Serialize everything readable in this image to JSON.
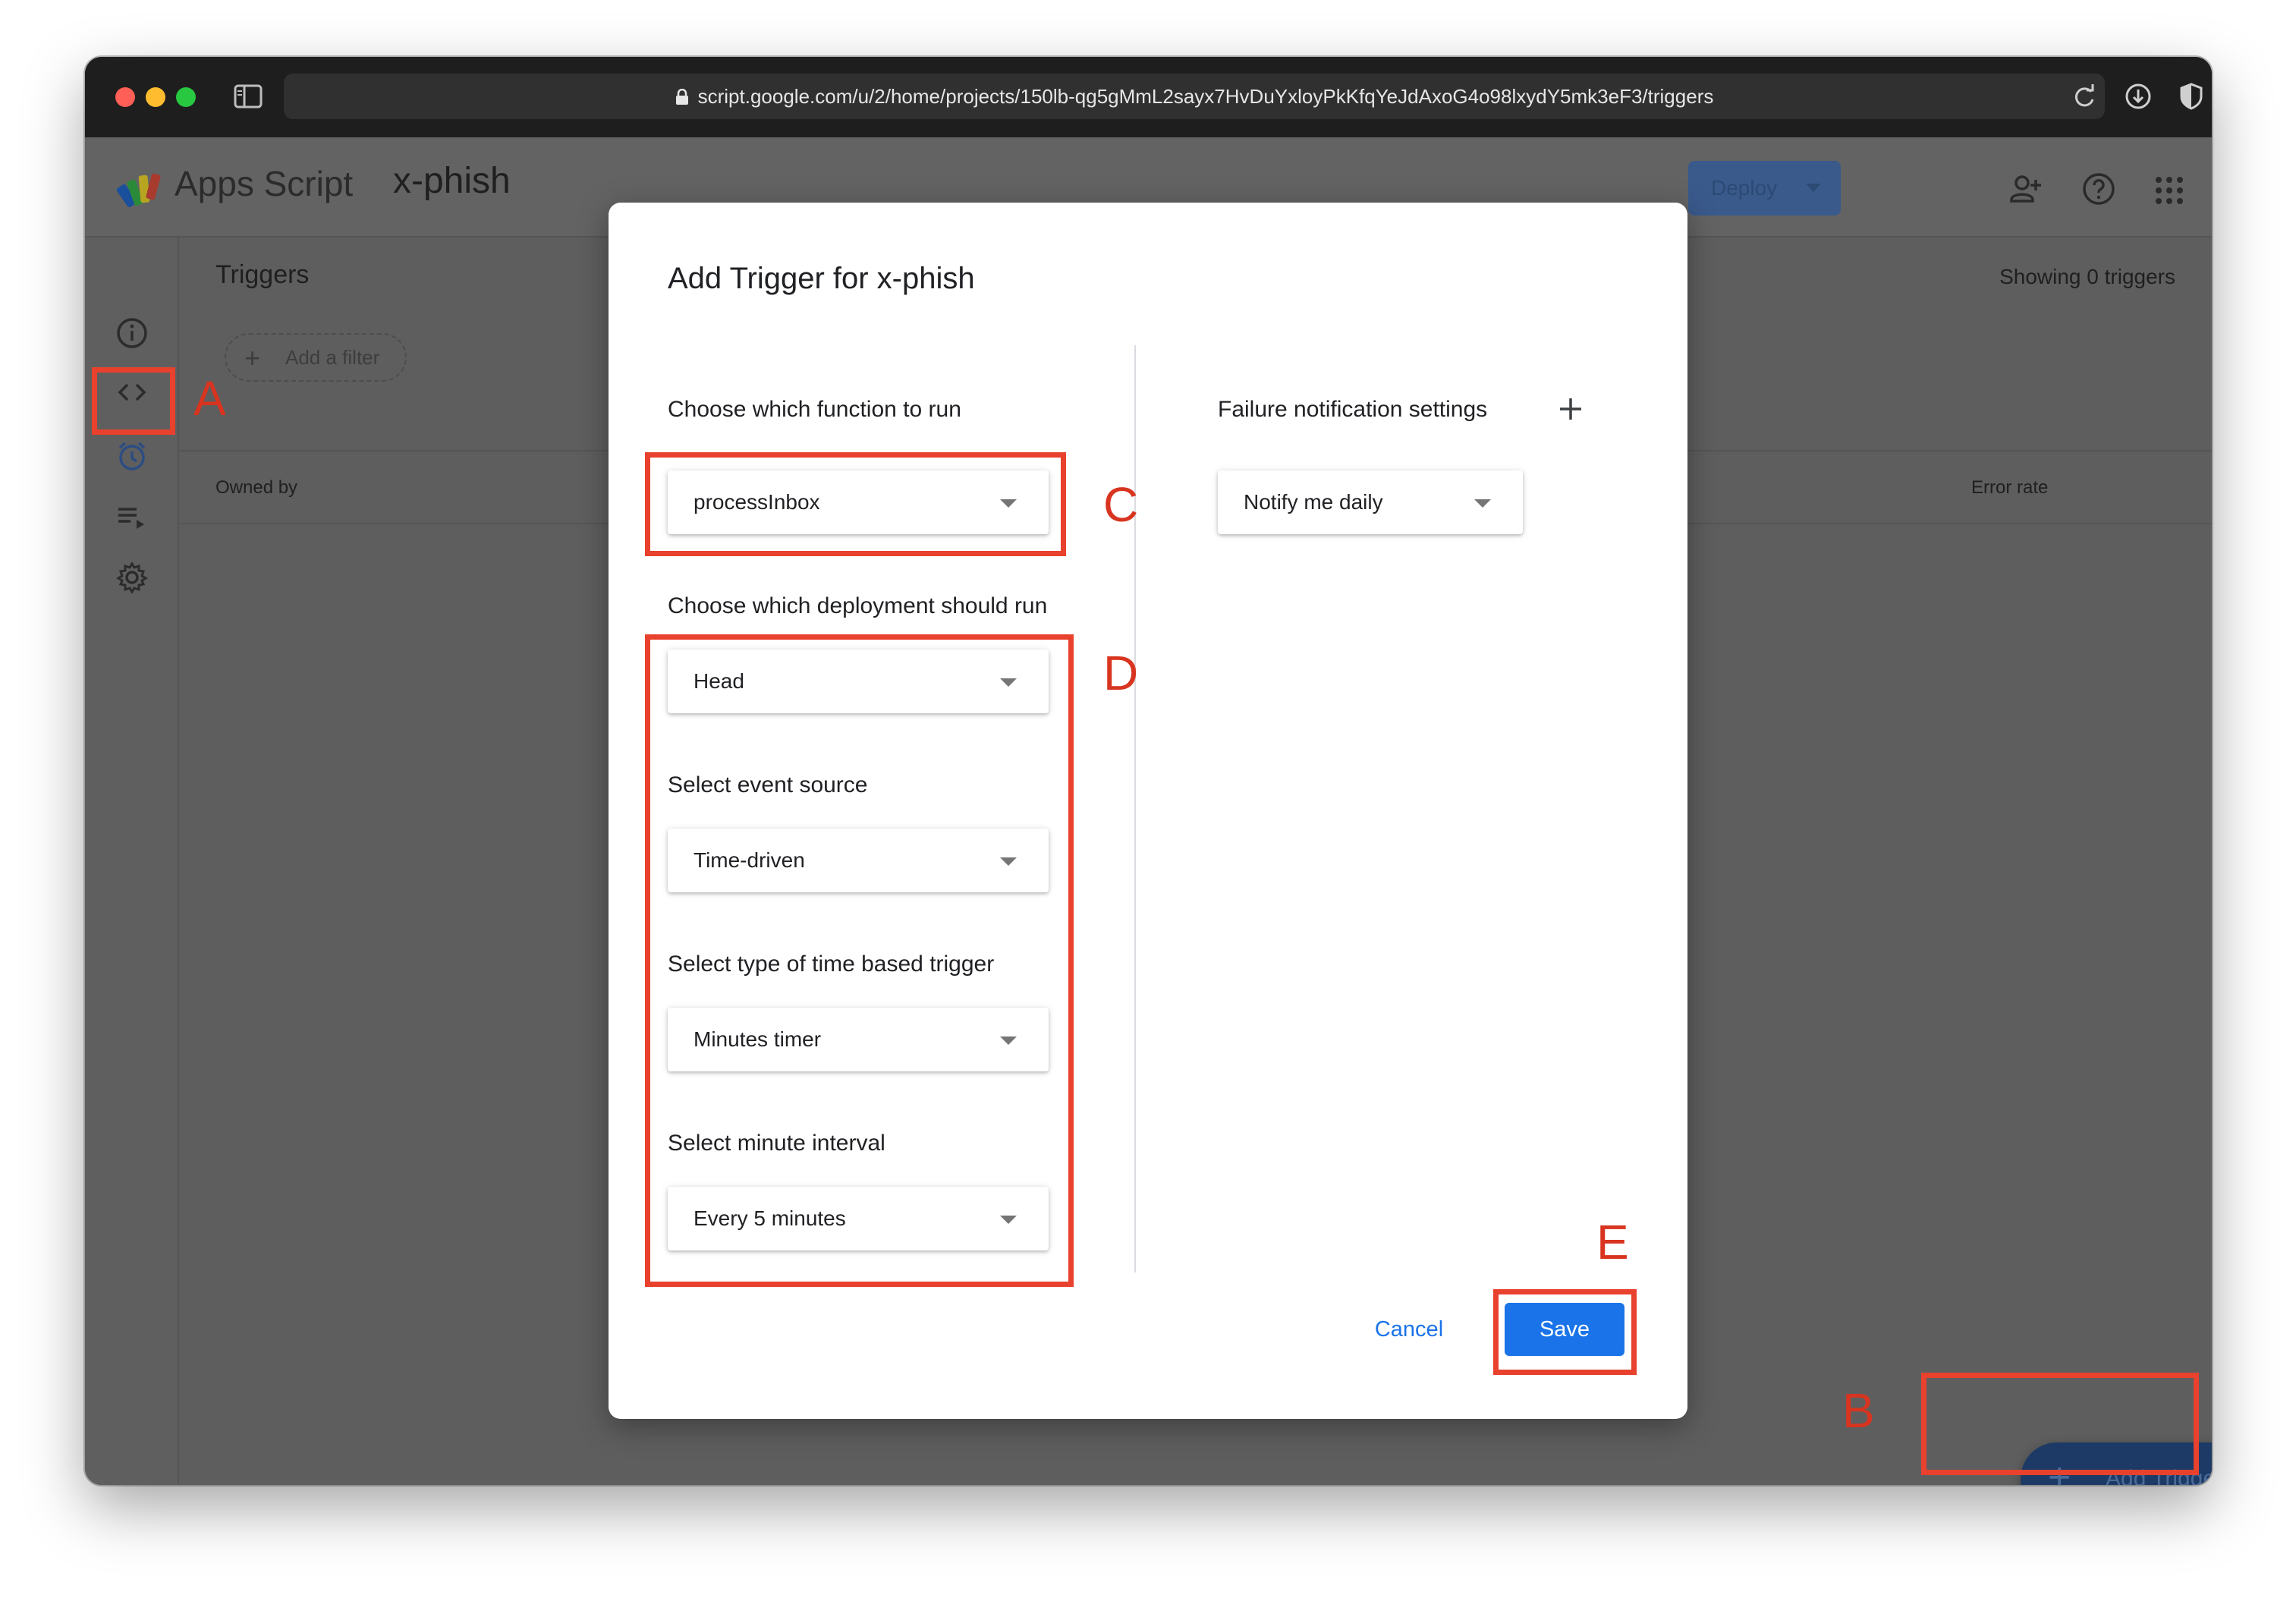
{
  "browser": {
    "url": "script.google.com/u/2/home/projects/150lb-qg5gMmL2sayx7HvDuYxloyPkKfqYeJdAxoG4o98lxydY5mk3eF3/triggers",
    "icons": [
      "sidebar-icon",
      "lock-icon",
      "reload-icon",
      "download-icon",
      "shield-icon",
      "extension-icon"
    ]
  },
  "header": {
    "app_name": "Apps Script",
    "project_name": "x-phish",
    "deploy_label": "Deploy"
  },
  "sidebar": {
    "items": [
      {
        "name": "overview",
        "icon": "info-icon"
      },
      {
        "name": "editor",
        "icon": "code-icon"
      },
      {
        "name": "triggers",
        "icon": "alarm-clock-icon",
        "active": true
      },
      {
        "name": "executions",
        "icon": "executions-icon"
      },
      {
        "name": "settings",
        "icon": "gear-icon"
      }
    ]
  },
  "main": {
    "title": "Triggers",
    "showing": "Showing 0 triggers",
    "filter_label": "Add a filter",
    "columns": [
      "Owned by",
      "Error rate"
    ],
    "fab_label": "Add Trigger"
  },
  "dialog": {
    "title": "Add Trigger for x-phish",
    "function_label": "Choose which function to run",
    "function_value": "processInbox",
    "deployment_label": "Choose which deployment should run",
    "deployment_value": "Head",
    "event_source_label": "Select event source",
    "event_source_value": "Time-driven",
    "time_type_label": "Select type of time based trigger",
    "time_type_value": "Minutes timer",
    "interval_label": "Select minute interval",
    "interval_value": "Every 5 minutes",
    "failure_label": "Failure notification settings",
    "failure_value": "Notify me daily",
    "cancel_label": "Cancel",
    "save_label": "Save"
  },
  "annotations": {
    "a": "A",
    "b": "B",
    "c": "C",
    "d": "D",
    "e": "E"
  },
  "colors": {
    "callout": "#e8412d",
    "primary": "#1a73e8",
    "overlay": "#5f5f5f"
  }
}
